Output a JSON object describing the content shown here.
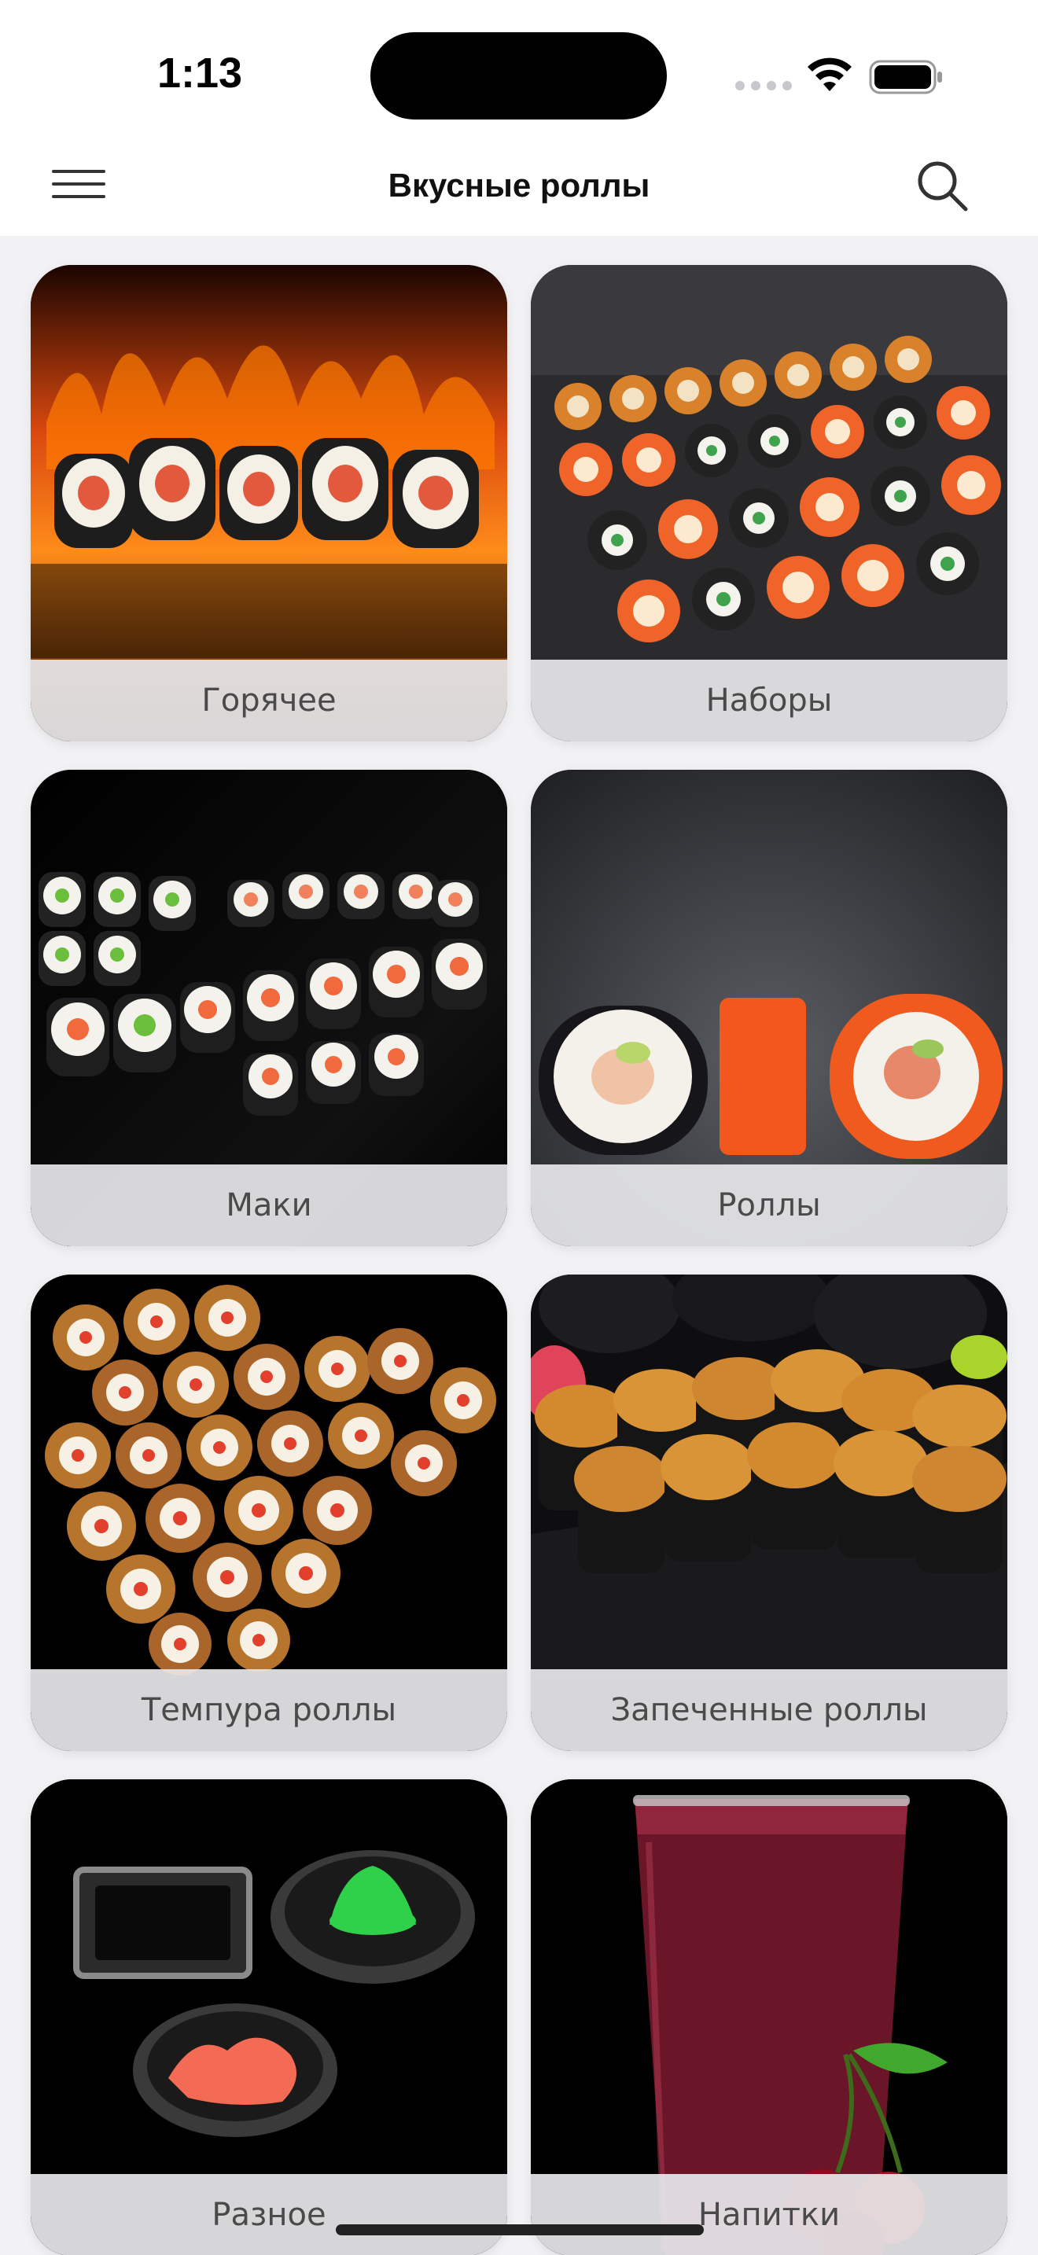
{
  "status": {
    "time": "1:13"
  },
  "nav": {
    "title": "Вкусные роллы"
  },
  "categories": [
    {
      "label": "Горячее"
    },
    {
      "label": "Наборы"
    },
    {
      "label": "Маки"
    },
    {
      "label": "Роллы"
    },
    {
      "label": "Темпура роллы"
    },
    {
      "label": "Запеченные роллы"
    },
    {
      "label": "Разное"
    },
    {
      "label": "Напитки"
    }
  ],
  "colors": {
    "background": "#f2f2f4",
    "label_bar": "#e8e8ea",
    "label_text": "#4a4a4a"
  }
}
